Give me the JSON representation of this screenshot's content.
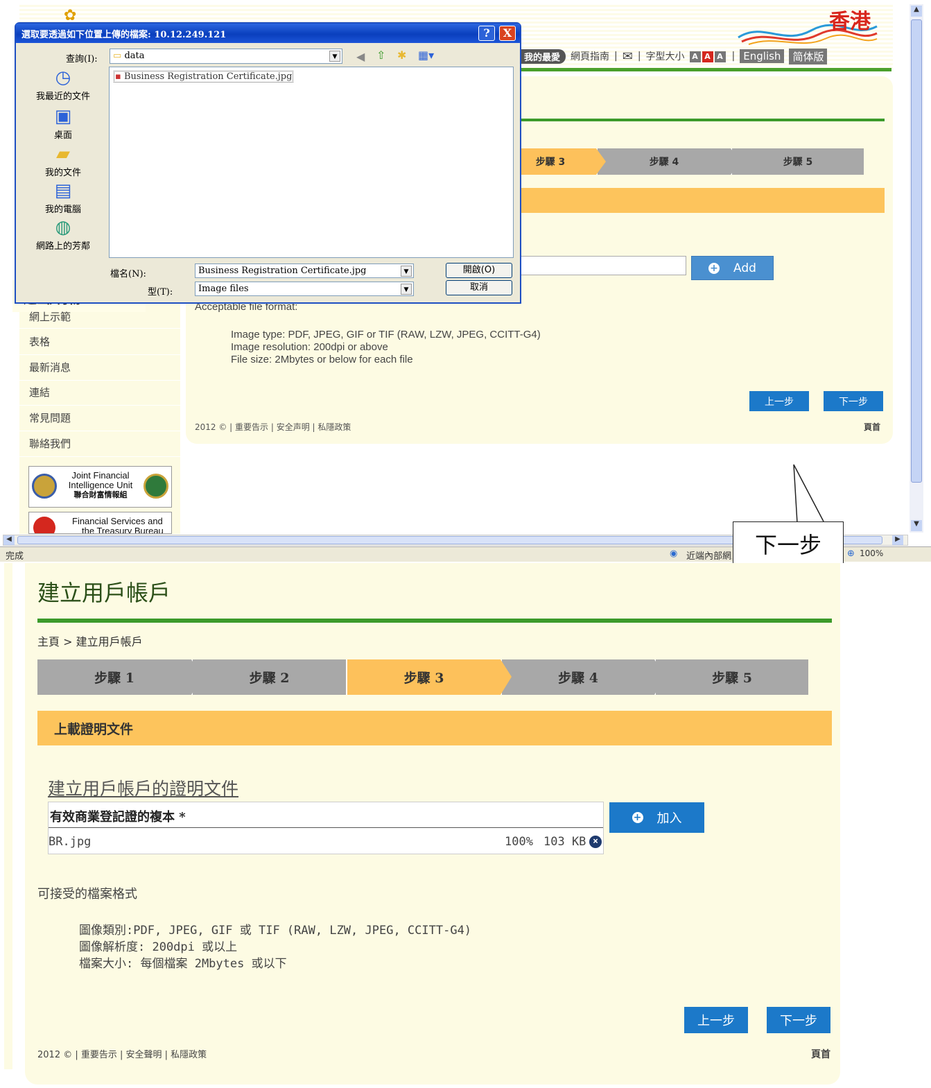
{
  "top": {
    "logo": "香港",
    "nav": {
      "favorites": "我的最愛",
      "guide": "網頁指南",
      "font_size": "字型大小",
      "font_sizes": [
        "A",
        "A",
        "A"
      ],
      "english": "English",
      "simplified": "简体版"
    },
    "steps": [
      "步驟 3",
      "步驟 4",
      "步驟 5"
    ],
    "add_label": "Add",
    "format": {
      "heading": "Acceptable file format:",
      "lines": [
        "Image type: PDF, JPEG, GIF or TIF (RAW, LZW, JPEG, CCITT-G4)",
        "Image resolution: 200dpi or above",
        "File size: 2Mbytes or below for each file"
      ]
    },
    "prev": "上一步",
    "next": "下一步",
    "footer": "2012 © | 重要告示 | 安全声明 | 私隱政策",
    "home": "頁首",
    "sidebar": {
      "title": "通函/刊物",
      "items": [
        "網上示範",
        "表格",
        "最新消息",
        "連結",
        "常見問題",
        "聯絡我們"
      ],
      "banner1": {
        "line1": "Joint Financial",
        "line2": "Intelligence Unit",
        "line3": "聯合財富情報組"
      },
      "banner2": {
        "line1": "Financial Services and",
        "line2": "the Treasury Bureau"
      }
    },
    "status": {
      "left": "完成",
      "zone": "近端內部網路",
      "zoom": "100%"
    }
  },
  "dialog": {
    "title": "選取要透過如下位置上傳的檔案: 10.12.249.121",
    "lookin_label": "查詢(I):",
    "lookin_value": "data",
    "places": [
      "我最近的文件",
      "桌面",
      "我的文件",
      "我的電腦",
      "網路上的芳鄰"
    ],
    "file": "Business Registration Certificate.jpg",
    "filename_label": "檔名(N):",
    "filename_value": "Business Registration Certificate.jpg",
    "filetype_label": "型(T):",
    "filetype_value": "Image files",
    "open": "開啟(O)",
    "cancel": "取消",
    "help": "?",
    "close": "X"
  },
  "callout": "下一步",
  "bottom": {
    "title": "建立用戶帳戶",
    "breadcrumb": "主頁 > 建立用戶帳戶",
    "steps": [
      "步驟 1",
      "步驟 2",
      "步驟 3",
      "步驟 4",
      "步驟 5"
    ],
    "section": "上載證明文件",
    "doc_title": "建立用戶帳戶的證明文件",
    "table_header": "有效商業登記證的複本 *",
    "file": {
      "name": "BR.jpg",
      "progress": "100%",
      "size": "103 KB"
    },
    "add_label": "加入",
    "format": {
      "heading": "可接受的檔案格式",
      "lines": [
        "圖像類別:PDF, JPEG, GIF 或 TIF (RAW, LZW, JPEG, CCITT-G4)",
        "圖像解析度: 200dpi 或以上",
        "檔案大小: 每個檔案 2Mbytes 或以下"
      ]
    },
    "prev": "上一步",
    "next": "下一步",
    "footer": "2012 © | 重要告示 | 安全聲明 | 私隱政策",
    "home": "頁首"
  }
}
